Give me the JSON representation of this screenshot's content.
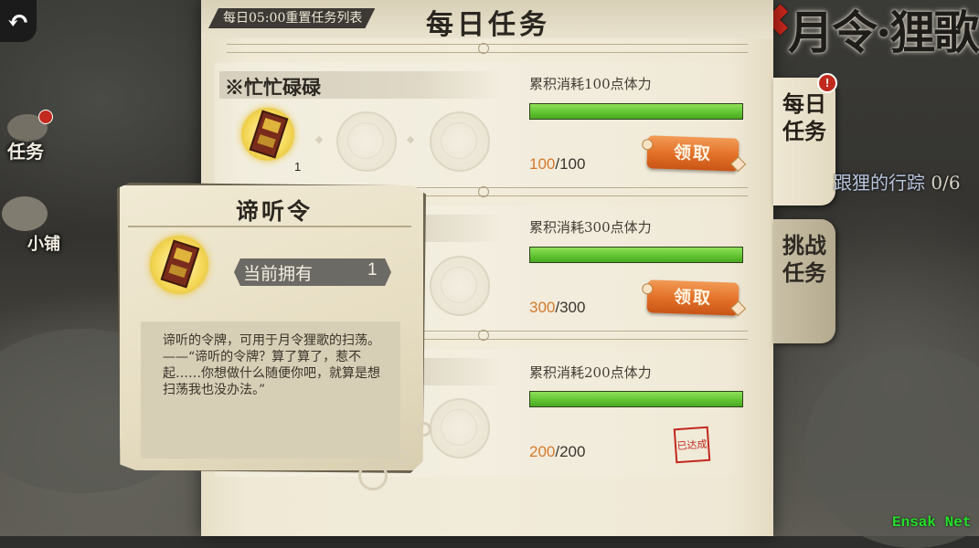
{
  "header": {
    "reset_notice": "每日05:00重置任务列表",
    "panel_title": "每日任务",
    "game_title": "月令·狸歌"
  },
  "left_nav": {
    "tasks_label": "任务",
    "shop_label": "小铺"
  },
  "tabs": [
    {
      "label": "每日任务",
      "active": true,
      "badge": "!"
    },
    {
      "label": "挑战任务",
      "active": false
    }
  ],
  "behind_panel_text": "跟狸的行踪",
  "behind_panel_count": "0/6",
  "tasks": [
    {
      "name": "※忙忙碌碌",
      "requirement": "累积消耗100点体力",
      "progress_current": "100",
      "progress_max": "/100",
      "progress_fraction": 1.0,
      "reward_qty": "1",
      "action": "领取"
    },
    {
      "name": "",
      "requirement": "累积消耗300点体力",
      "progress_current": "300",
      "progress_max": "/300",
      "progress_fraction": 1.0,
      "action": "领取"
    },
    {
      "name": "",
      "requirement": "累积消耗200点体力",
      "progress_current": "200",
      "progress_max": "/200",
      "progress_fraction": 1.0,
      "stamp": "已达成"
    }
  ],
  "popup": {
    "title": "谛听令",
    "own_label": "当前拥有",
    "own_value": "1",
    "description": "谛听的令牌，可用于月令狸歌的扫荡。\n——“谛听的令牌？算了算了，惹不起……你想做什么随便你吧，就算是想扫荡我也没办法。”"
  },
  "watermark": "Ensak Net",
  "colors": {
    "progress_green": "#5fc22f",
    "claim_orange": "#e26f26",
    "count_orange": "#d47a2c",
    "badge_red": "#c22a1e",
    "close_red": "#c6261b"
  }
}
